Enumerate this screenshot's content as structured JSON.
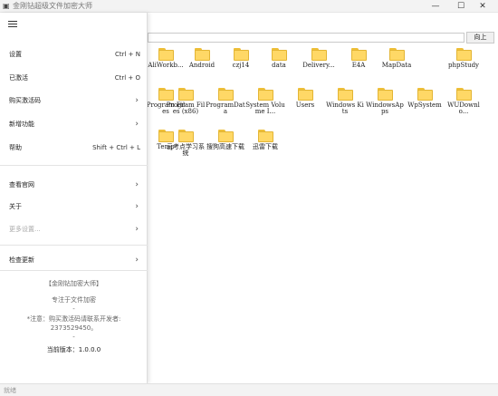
{
  "window": {
    "title": "金刚钻超级文件加密大师",
    "minimize_glyph": "—",
    "maximize_glyph": "☐",
    "close_glyph": "✕",
    "app_icon": "lock-icon"
  },
  "toolbar": {
    "up_label": "向上"
  },
  "files": [
    "AliWorkb...",
    "Android",
    "czj14",
    "data",
    "Delivery...",
    "E4A",
    "MapData",
    "phpStudy",
    "Program Files",
    "Program Files (x86)",
    "ProgramData",
    "System Volume I...",
    "Users",
    "Windows Kits",
    "WindowsApps",
    "WpSystem",
    "WUDownlo...",
    "Temp",
    "云考点学习系统",
    "搜狗高速下载",
    "迅雷下载"
  ],
  "drawer": {
    "items": [
      {
        "label": "设置",
        "shortcut": "Ctrl + N"
      },
      {
        "label": "已激活",
        "shortcut": "Ctrl + O"
      },
      {
        "label": "购买激活码",
        "chevron": "›"
      },
      {
        "label": "新增功能",
        "chevron": "›"
      },
      {
        "label": "帮助",
        "shortcut": "Shift + Ctrl + L"
      },
      {
        "label": "查看官网",
        "chevron": "›"
      },
      {
        "label": "关于",
        "chevron": "›"
      },
      {
        "label": "更多设置...",
        "chevron": "›"
      },
      {
        "label": "检查更新",
        "chevron": "›"
      }
    ],
    "about": {
      "name": "【金刚钻加密大师】",
      "tagline": "专注于文件加密",
      "sep1": "-",
      "note": "*注意：购买激活码请联系开发者:",
      "contact": "2373529450。",
      "sep2": "-",
      "version": "当前版本：1.0.0.0"
    }
  },
  "status": {
    "text": "就绪"
  }
}
